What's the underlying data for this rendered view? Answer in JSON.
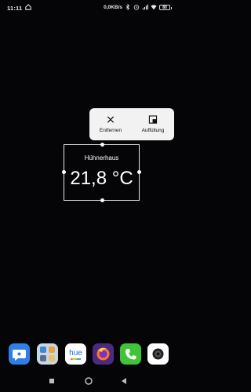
{
  "status_bar": {
    "time": "11:11",
    "net_speed": "0,0KB/s",
    "battery": "80",
    "icons": [
      "home-icon",
      "bluetooth-icon",
      "alarm-icon",
      "signal-icon",
      "wifi-icon",
      "battery-icon"
    ]
  },
  "context_menu": {
    "remove_label": "Entfernen",
    "refill_label": "Auffüllung",
    "remove_icon": "close-icon",
    "refill_icon": "resize-icon"
  },
  "widget": {
    "title": "Hühnerhaus",
    "temperature": "21,8 °C"
  },
  "dock": {
    "apps": [
      "messages-app-icon",
      "app-folder-icon",
      "hue-app-icon",
      "firefox-app-icon",
      "phone-app-icon",
      "camera-app-icon"
    ],
    "hue_label": "hue"
  },
  "navigation": {
    "buttons": [
      "recents-button",
      "home-button",
      "back-button"
    ]
  },
  "colors": {
    "background": "#050507",
    "menu_bg": "#f2f2f2",
    "messages_blue": "#2f7fe6",
    "phone_green": "#3fc43a",
    "firefox_purple": "#4b2a82"
  }
}
